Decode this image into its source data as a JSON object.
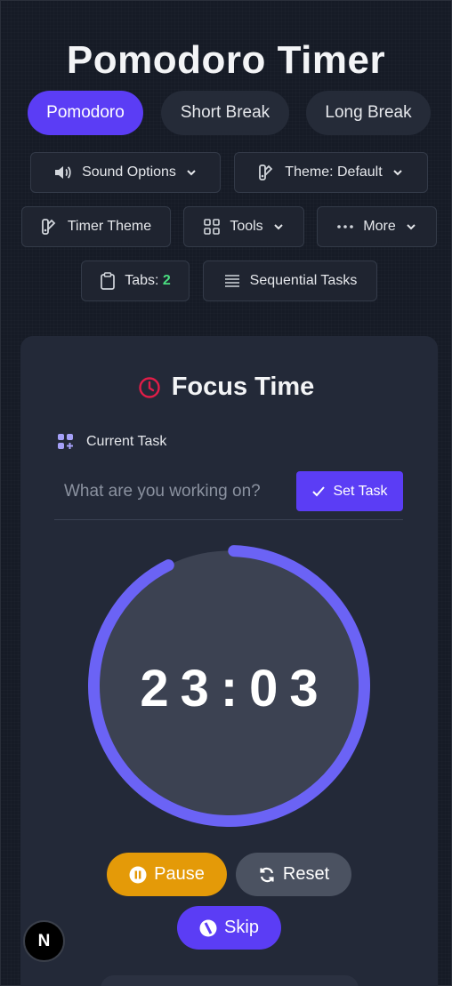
{
  "app": {
    "title": "Pomodoro Timer"
  },
  "modes": [
    {
      "label": "Pomodoro",
      "active": true
    },
    {
      "label": "Short Break",
      "active": false
    },
    {
      "label": "Long Break",
      "active": false
    }
  ],
  "toolbar": {
    "sound_label": "Sound Options",
    "theme_label": "Theme: Default",
    "timer_theme_label": "Timer Theme",
    "tools_label": "Tools",
    "more_label": "More",
    "tabs_label": "Tabs:",
    "tabs_count": "2",
    "sequential_label": "Sequential Tasks"
  },
  "focus": {
    "title": "Focus Time",
    "current_task_label": "Current Task",
    "task_placeholder": "What are you working on?",
    "set_task_label": "Set Task"
  },
  "timer": {
    "display": "23:03",
    "progress": 0.92
  },
  "controls": {
    "pause_label": "Pause",
    "reset_label": "Reset",
    "skip_label": "Skip"
  },
  "colors": {
    "accent": "#5b3df5",
    "pause": "#e49a08",
    "reset": "#4b5261",
    "ring": "#6b63f5",
    "clock_icon": "#e11d48",
    "tabs_count": "#4ade80"
  },
  "logo": {
    "text": "N"
  }
}
